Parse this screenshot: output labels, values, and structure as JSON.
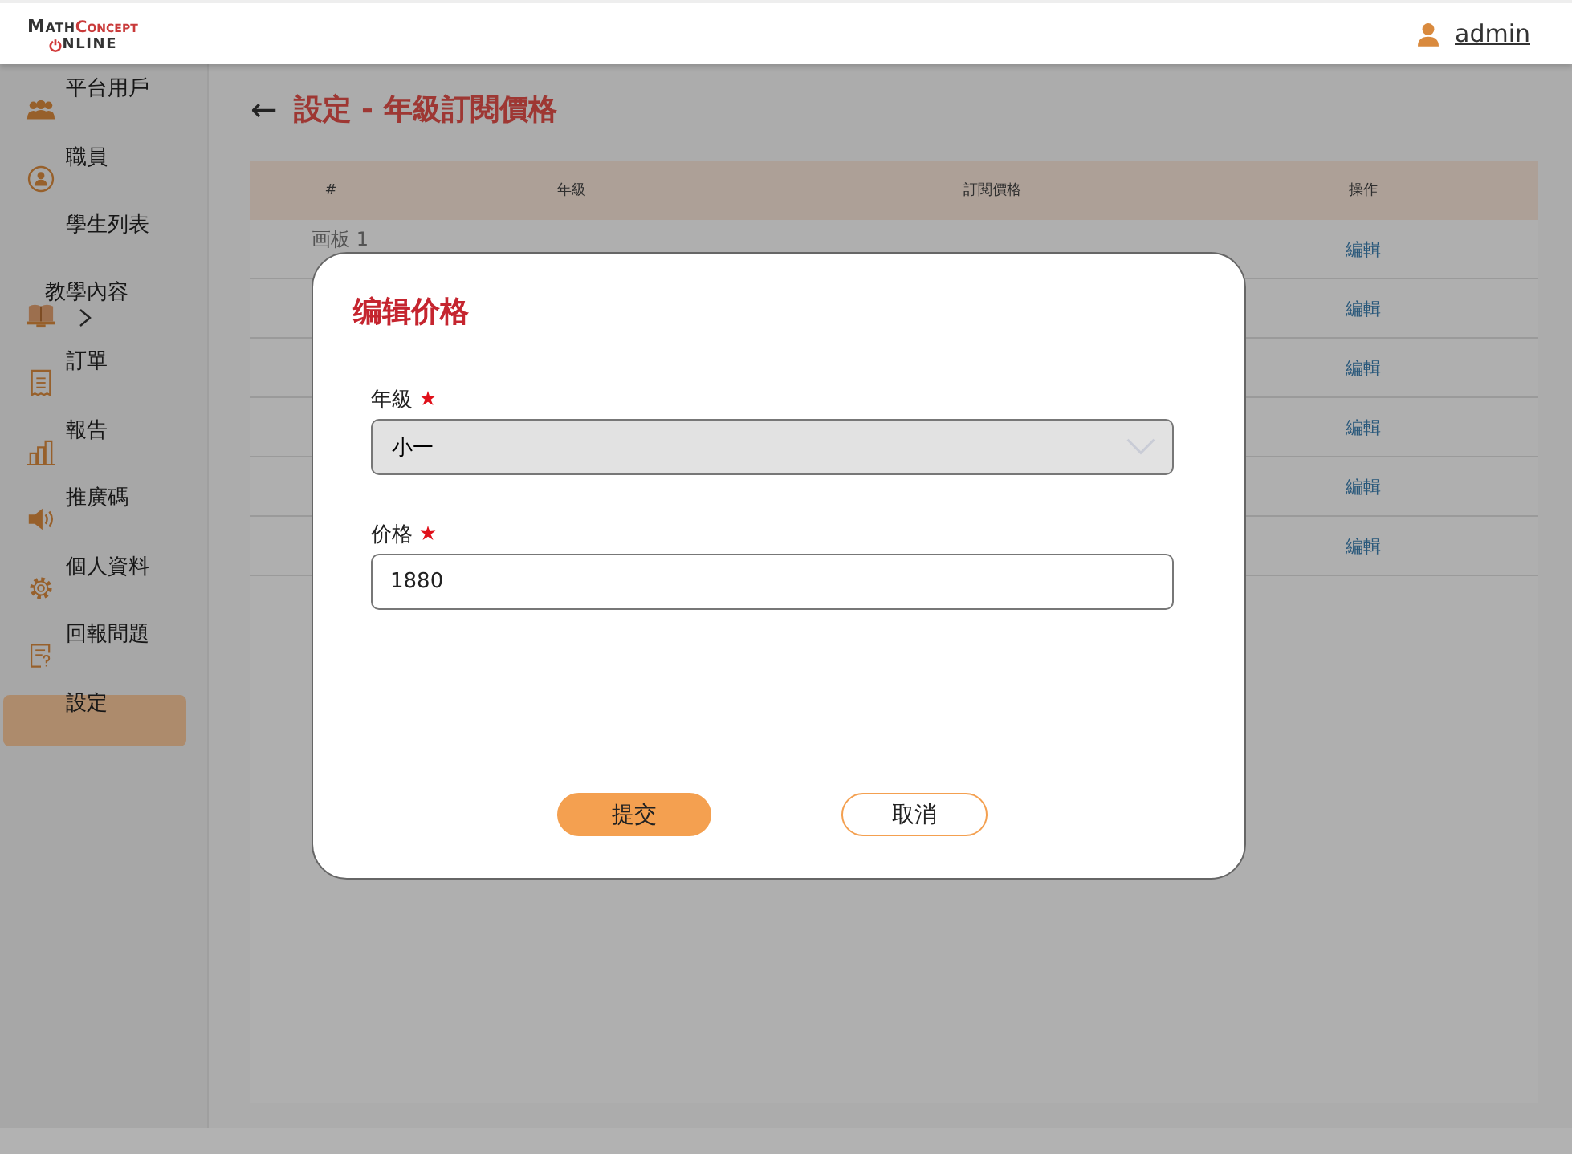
{
  "header": {
    "logo": {
      "word1": "Math",
      "word2": "Concept",
      "word3": "NLINE"
    },
    "user": "admin"
  },
  "sidebar": {
    "items": [
      {
        "label": "平台用戶",
        "selected": false,
        "expandable": false
      },
      {
        "label": "職員",
        "selected": false,
        "expandable": false
      },
      {
        "label": "學生列表",
        "selected": false,
        "expandable": false
      },
      {
        "label": "教學內容",
        "selected": false,
        "expandable": true
      },
      {
        "label": "訂單",
        "selected": false,
        "expandable": false
      },
      {
        "label": "報告",
        "selected": false,
        "expandable": false
      },
      {
        "label": "推廣碼",
        "selected": false,
        "expandable": false
      },
      {
        "label": "個人資料",
        "selected": false,
        "expandable": false
      },
      {
        "label": "回報問題",
        "selected": false,
        "expandable": false
      },
      {
        "label": "設定",
        "selected": true,
        "expandable": false
      }
    ]
  },
  "page": {
    "back": "←",
    "title": "設定 - 年級訂閱價格"
  },
  "artboard_label": "画板 1",
  "table": {
    "columns": [
      "#",
      "年級",
      "訂閱價格",
      "操作"
    ],
    "rows": [
      {
        "action": "編輯"
      },
      {
        "action": "編輯"
      },
      {
        "action": "編輯"
      },
      {
        "action": "編輯"
      },
      {
        "action": "編輯"
      },
      {
        "action": "編輯"
      }
    ]
  },
  "dialog": {
    "title": "编辑价格",
    "fields": [
      {
        "kind": "select",
        "label": "年級",
        "required": true,
        "value": "小一"
      },
      {
        "kind": "text",
        "label": "价格",
        "required": true,
        "value": "1880"
      }
    ],
    "buttons": [
      {
        "label": "提交",
        "primary": true
      },
      {
        "label": "取消",
        "primary": false
      }
    ]
  }
}
